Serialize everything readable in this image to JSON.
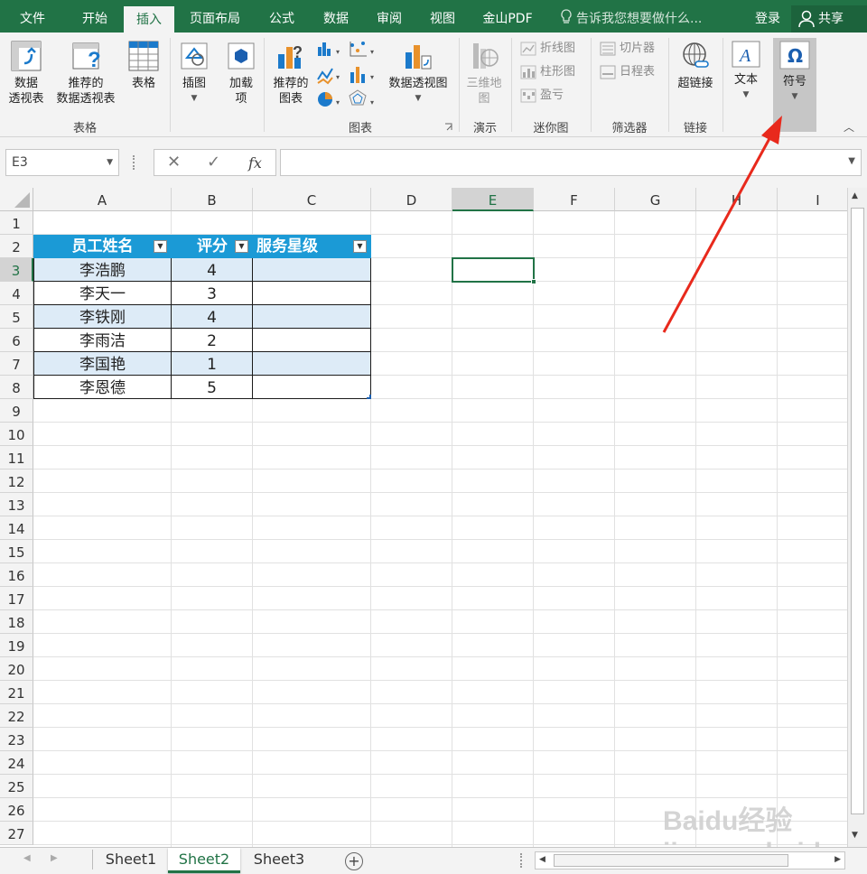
{
  "ribbon_tabs": [
    "文件",
    "开始",
    "插入",
    "页面布局",
    "公式",
    "数据",
    "审阅",
    "视图",
    "金山PDF"
  ],
  "tell_me": "告诉我您想要做什么...",
  "login": "登录",
  "share": "共享",
  "ribbon": {
    "groups": [
      "表格",
      "图表",
      "演示",
      "迷你图",
      "筛选器",
      "链接"
    ],
    "pivot_line1": "数据",
    "pivot_line2": "透视表",
    "rec_pivot_line1": "推荐的",
    "rec_pivot_line2": "数据透视表",
    "table": "表格",
    "illustrations": "插图",
    "addins_line1": "加载",
    "addins_line2": "项",
    "rec_chart_line1": "推荐的",
    "rec_chart_line2": "图表",
    "pivot_chart": "数据透视图",
    "map3d_line1": "三维地",
    "map3d_line2": "图",
    "spark_line": "折线图",
    "spark_column": "柱形图",
    "spark_winloss": "盈亏",
    "slicer": "切片器",
    "timeline": "日程表",
    "hyperlink": "超链接",
    "text": "文本",
    "symbol": "符号"
  },
  "formula_bar": {
    "name_box": "E3",
    "cancel": "✕",
    "enter": "✓",
    "fx": "fx",
    "formula": ""
  },
  "columns": [
    "A",
    "B",
    "C",
    "D",
    "E",
    "F",
    "G",
    "H",
    "I"
  ],
  "rows": [
    "1",
    "2",
    "3",
    "4",
    "5",
    "6",
    "7",
    "8",
    "9",
    "10",
    "11",
    "12",
    "13",
    "14",
    "15",
    "16",
    "17",
    "18",
    "19",
    "20",
    "21",
    "22",
    "23",
    "24",
    "25",
    "26",
    "27"
  ],
  "table": {
    "headers": [
      "员工姓名",
      "评分",
      "服务星级"
    ],
    "names": [
      "李浩鹏",
      "李天一",
      "李铁刚",
      "李雨洁",
      "李国艳",
      "李恩德"
    ],
    "scores": [
      "4",
      "3",
      "4",
      "2",
      "1",
      "5"
    ]
  },
  "sheets": [
    "Sheet1",
    "Sheet2",
    "Sheet3"
  ],
  "active_sheet": "Sheet2",
  "watermark": "Baidu经验 jingyan.baidu.com",
  "colors": {
    "excel_green": "#217346",
    "table_header": "#1b9ad6",
    "band_row": "#ddebf7",
    "arrow": "#e8291c"
  }
}
